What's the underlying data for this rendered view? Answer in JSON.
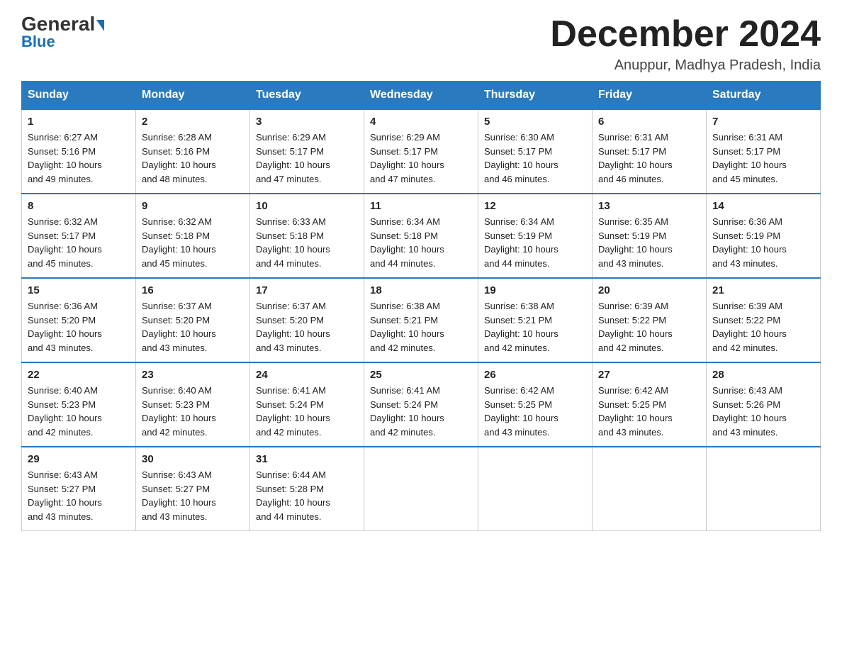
{
  "header": {
    "logo_general": "General",
    "logo_blue": "Blue",
    "month_title": "December 2024",
    "location": "Anuppur, Madhya Pradesh, India"
  },
  "weekdays": [
    "Sunday",
    "Monday",
    "Tuesday",
    "Wednesday",
    "Thursday",
    "Friday",
    "Saturday"
  ],
  "weeks": [
    [
      {
        "day": "1",
        "sunrise": "6:27 AM",
        "sunset": "5:16 PM",
        "daylight": "10 hours and 49 minutes."
      },
      {
        "day": "2",
        "sunrise": "6:28 AM",
        "sunset": "5:16 PM",
        "daylight": "10 hours and 48 minutes."
      },
      {
        "day": "3",
        "sunrise": "6:29 AM",
        "sunset": "5:17 PM",
        "daylight": "10 hours and 47 minutes."
      },
      {
        "day": "4",
        "sunrise": "6:29 AM",
        "sunset": "5:17 PM",
        "daylight": "10 hours and 47 minutes."
      },
      {
        "day": "5",
        "sunrise": "6:30 AM",
        "sunset": "5:17 PM",
        "daylight": "10 hours and 46 minutes."
      },
      {
        "day": "6",
        "sunrise": "6:31 AM",
        "sunset": "5:17 PM",
        "daylight": "10 hours and 46 minutes."
      },
      {
        "day": "7",
        "sunrise": "6:31 AM",
        "sunset": "5:17 PM",
        "daylight": "10 hours and 45 minutes."
      }
    ],
    [
      {
        "day": "8",
        "sunrise": "6:32 AM",
        "sunset": "5:17 PM",
        "daylight": "10 hours and 45 minutes."
      },
      {
        "day": "9",
        "sunrise": "6:32 AM",
        "sunset": "5:18 PM",
        "daylight": "10 hours and 45 minutes."
      },
      {
        "day": "10",
        "sunrise": "6:33 AM",
        "sunset": "5:18 PM",
        "daylight": "10 hours and 44 minutes."
      },
      {
        "day": "11",
        "sunrise": "6:34 AM",
        "sunset": "5:18 PM",
        "daylight": "10 hours and 44 minutes."
      },
      {
        "day": "12",
        "sunrise": "6:34 AM",
        "sunset": "5:19 PM",
        "daylight": "10 hours and 44 minutes."
      },
      {
        "day": "13",
        "sunrise": "6:35 AM",
        "sunset": "5:19 PM",
        "daylight": "10 hours and 43 minutes."
      },
      {
        "day": "14",
        "sunrise": "6:36 AM",
        "sunset": "5:19 PM",
        "daylight": "10 hours and 43 minutes."
      }
    ],
    [
      {
        "day": "15",
        "sunrise": "6:36 AM",
        "sunset": "5:20 PM",
        "daylight": "10 hours and 43 minutes."
      },
      {
        "day": "16",
        "sunrise": "6:37 AM",
        "sunset": "5:20 PM",
        "daylight": "10 hours and 43 minutes."
      },
      {
        "day": "17",
        "sunrise": "6:37 AM",
        "sunset": "5:20 PM",
        "daylight": "10 hours and 43 minutes."
      },
      {
        "day": "18",
        "sunrise": "6:38 AM",
        "sunset": "5:21 PM",
        "daylight": "10 hours and 42 minutes."
      },
      {
        "day": "19",
        "sunrise": "6:38 AM",
        "sunset": "5:21 PM",
        "daylight": "10 hours and 42 minutes."
      },
      {
        "day": "20",
        "sunrise": "6:39 AM",
        "sunset": "5:22 PM",
        "daylight": "10 hours and 42 minutes."
      },
      {
        "day": "21",
        "sunrise": "6:39 AM",
        "sunset": "5:22 PM",
        "daylight": "10 hours and 42 minutes."
      }
    ],
    [
      {
        "day": "22",
        "sunrise": "6:40 AM",
        "sunset": "5:23 PM",
        "daylight": "10 hours and 42 minutes."
      },
      {
        "day": "23",
        "sunrise": "6:40 AM",
        "sunset": "5:23 PM",
        "daylight": "10 hours and 42 minutes."
      },
      {
        "day": "24",
        "sunrise": "6:41 AM",
        "sunset": "5:24 PM",
        "daylight": "10 hours and 42 minutes."
      },
      {
        "day": "25",
        "sunrise": "6:41 AM",
        "sunset": "5:24 PM",
        "daylight": "10 hours and 42 minutes."
      },
      {
        "day": "26",
        "sunrise": "6:42 AM",
        "sunset": "5:25 PM",
        "daylight": "10 hours and 43 minutes."
      },
      {
        "day": "27",
        "sunrise": "6:42 AM",
        "sunset": "5:25 PM",
        "daylight": "10 hours and 43 minutes."
      },
      {
        "day": "28",
        "sunrise": "6:43 AM",
        "sunset": "5:26 PM",
        "daylight": "10 hours and 43 minutes."
      }
    ],
    [
      {
        "day": "29",
        "sunrise": "6:43 AM",
        "sunset": "5:27 PM",
        "daylight": "10 hours and 43 minutes."
      },
      {
        "day": "30",
        "sunrise": "6:43 AM",
        "sunset": "5:27 PM",
        "daylight": "10 hours and 43 minutes."
      },
      {
        "day": "31",
        "sunrise": "6:44 AM",
        "sunset": "5:28 PM",
        "daylight": "10 hours and 44 minutes."
      },
      null,
      null,
      null,
      null
    ]
  ],
  "labels": {
    "sunrise": "Sunrise:",
    "sunset": "Sunset:",
    "daylight": "Daylight:"
  }
}
